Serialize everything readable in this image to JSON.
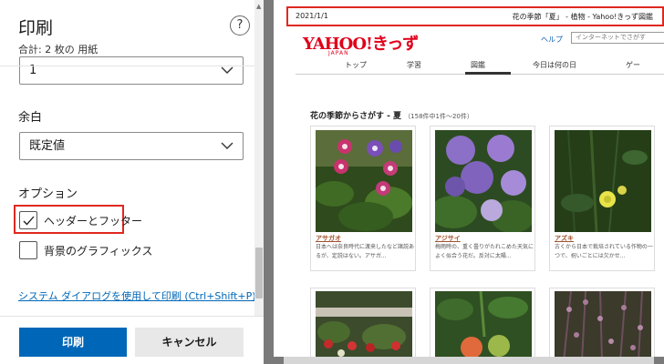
{
  "panel": {
    "title": "印刷",
    "help_label": "?",
    "sheet_count": "合計: 2 枚の 用紙",
    "pages_value": "1",
    "margin_label": "余白",
    "margin_value": "既定値",
    "options_label": "オプション",
    "options": [
      {
        "label": "ヘッダーとフッター",
        "checked": true
      },
      {
        "label": "背景のグラフィックス",
        "checked": false
      }
    ],
    "system_dialog_link": "システム ダイアログを使用して印刷 (Ctrl+Shift+P)",
    "print_button": "印刷",
    "cancel_button": "キャンセル"
  },
  "preview": {
    "header_date": "2021/1/1",
    "header_title": "花の季節「夏」 - 植物 - Yahoo!きっず図鑑",
    "logo_text": "YAHOO!きっず",
    "logo_sub": "JAPAN",
    "help_link": "ヘルプ",
    "search_placeholder": "インターネットでさがす",
    "nav_tabs": [
      "トップ",
      "学習",
      "図鑑",
      "今日は何の日",
      "ゲー"
    ],
    "active_tab": "図鑑",
    "section_heading": "花の季節からさがす - 夏",
    "section_count": "（158件中1件〜20件）",
    "cards": [
      {
        "name": "アサガオ",
        "desc": "日本へは奈良時代に渡来したなど諸説あるが、定説はない。アサガ..."
      },
      {
        "name": "アジサイ",
        "desc": "梅雨時の、重く曇りがたれこめた天気によく似合う花だ。反対に太陽..."
      },
      {
        "name": "アズキ",
        "desc": "古くから日本で栽培されている作物の一つで、祝いごとには欠かせ..."
      }
    ]
  },
  "colors": {
    "accent": "#0067b8",
    "highlight": "#e0281f",
    "logo": "#e0001b",
    "preview_bg": "#7a7a7a"
  }
}
